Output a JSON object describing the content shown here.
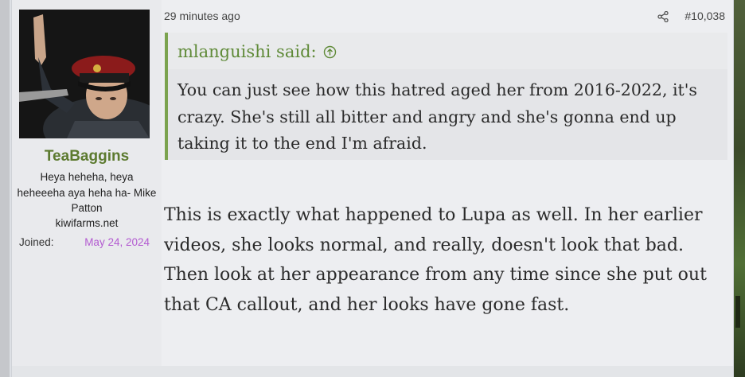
{
  "user": {
    "name": "TeaBaggins",
    "title": "Heya heheha, heya heheeeha aya heha ha- Mike Patton",
    "banner": "kiwifarms.net",
    "joined_label": "Joined:",
    "joined_date": "May 24, 2024"
  },
  "post": {
    "time": "29 minutes ago",
    "number": "#10,038"
  },
  "quote": {
    "author": "mlanguishi said:",
    "text": "You can just see how this hatred aged her from 2016-2022, it's crazy. She's still all bitter and angry and she's gonna end up taking it to the end I'm afraid."
  },
  "message": {
    "text": "This is exactly what happened to Lupa as well. In her earlier videos, she looks normal, and really, doesn't look that bad. Then look at her appearance from any time since she put out that CA callout, and her looks have gone fast."
  },
  "colors": {
    "username": "#5c7a2f",
    "quote_accent": "#7ba34f",
    "joined_date": "#b35bd1"
  },
  "icons": {
    "share": "share-icon",
    "jump_to_quote": "arrow-up-circle-icon"
  }
}
